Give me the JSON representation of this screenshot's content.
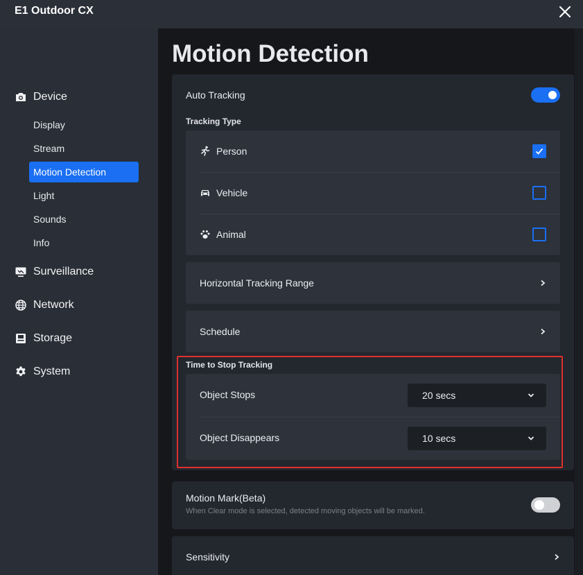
{
  "window": {
    "title": "E1 Outdoor CX"
  },
  "sidebar": {
    "device_label": "Device",
    "device_items": [
      "Display",
      "Stream",
      "Motion Detection",
      "Light",
      "Sounds",
      "Info"
    ],
    "surveillance_label": "Surveillance",
    "network_label": "Network",
    "storage_label": "Storage",
    "system_label": "System"
  },
  "page": {
    "title": "Motion Detection"
  },
  "auto_tracking": {
    "label": "Auto Tracking",
    "enabled": true,
    "tracking_type_title": "Tracking Type",
    "types": [
      {
        "label": "Person",
        "icon": "running-person-icon",
        "checked": true
      },
      {
        "label": "Vehicle",
        "icon": "car-icon",
        "checked": false
      },
      {
        "label": "Animal",
        "icon": "paw-icon",
        "checked": false
      }
    ],
    "horizontal_range_label": "Horizontal Tracking Range",
    "schedule_label": "Schedule",
    "stop_tracking_title": "Time to Stop Tracking",
    "object_stops_label": "Object Stops",
    "object_stops_value": "20 secs",
    "object_disappears_label": "Object Disappears",
    "object_disappears_value": "10 secs"
  },
  "motion_mark": {
    "label": "Motion Mark(Beta)",
    "description": "When Clear mode is selected, detected moving objects will be marked.",
    "enabled": false
  },
  "sensitivity": {
    "label": "Sensitivity"
  },
  "colors": {
    "accent": "#1a6ff3",
    "highlight": "#e0302d"
  }
}
